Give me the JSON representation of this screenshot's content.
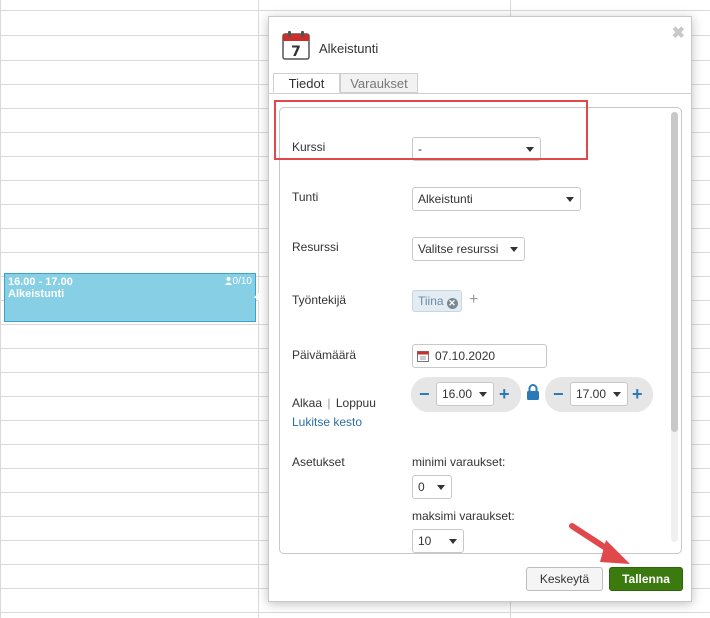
{
  "event": {
    "time": "16.00 - 17.00",
    "title": "Alkeistunti",
    "count": "0/10"
  },
  "dialog": {
    "title": "Alkeistunti",
    "icon_day": "7",
    "tabs": [
      {
        "label": "Tiedot"
      },
      {
        "label": "Varaukset"
      }
    ],
    "fields": {
      "kurssi": {
        "label": "Kurssi",
        "value": "-"
      },
      "tunti": {
        "label": "Tunti",
        "value": "Alkeistunti"
      },
      "resurssi": {
        "label": "Resurssi",
        "value": "Valitse resurssi"
      },
      "tyontekija": {
        "label": "Työntekijä",
        "tag": "Tiina"
      },
      "paivamaara": {
        "label": "Päivämäärä",
        "value": "07.10.2020"
      },
      "alkaa_loppuu": {
        "label_start": "Alkaa",
        "separator": "|",
        "label_end": "Loppuu",
        "lock_link": "Lukitse kesto",
        "start": "16.00",
        "end": "17.00"
      },
      "asetukset": {
        "label": "Asetukset",
        "min_label": "minimi varaukset:",
        "min_value": "0",
        "max_label": "maksimi varaukset:",
        "max_value": "10"
      }
    },
    "buttons": {
      "cancel": "Keskeytä",
      "save": "Tallenna"
    },
    "close_symbol": "✖"
  },
  "colors": {
    "highlight": "#e0484b",
    "save_button": "#3a7a0f",
    "event_bg": "#86cfe4",
    "accent_blue": "#2a7ab8"
  }
}
